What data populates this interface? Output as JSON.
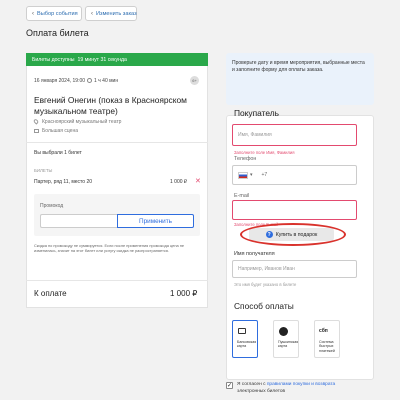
{
  "nav": {
    "back_event": "Выбор события",
    "change_order": "Изменить заказ"
  },
  "page_title": "Оплата билета",
  "timer_bar": {
    "label": "Билеты доступны",
    "time": "19 минут 31 секунда"
  },
  "event": {
    "date": "16 января 2024, 19:00",
    "duration": "1 ч 40 мин",
    "age": "6+",
    "title": "Евгений Онегин (показ в Красноярском музыкальном театре)",
    "venue": "Красноярский музыкальный театр",
    "hall": "Большая сцена"
  },
  "tickets": {
    "count_text": "Вы выбрали 1 билет",
    "section_label": "Билеты",
    "seat": "Партер, ряд 11, место 20",
    "price": "1 000 ₽"
  },
  "promo": {
    "label": "Промокод",
    "apply_button": "Применить",
    "note": "Скидка по промокоду не суммируется. Если после применения промокода цена не изменилась, значит на этот билет или услугу скидка не распространяется."
  },
  "total": {
    "label": "К оплате",
    "amount": "1 000 ₽"
  },
  "hint_text": "Проверьте дату и время мероприятия, выбранные места и заполните форму для оплаты заказа.",
  "buyer": {
    "heading": "Покупатель",
    "name_placeholder": "Имя, Фамилия",
    "name_error": "Заполните поле Имя, Фамилия",
    "phone_label": "Телефон",
    "phone_code": "+7",
    "email_label": "E-mail",
    "email_error": "Заполните поле E-mail",
    "gift_button": "Купить в подарок",
    "recipient_label": "Имя получателя",
    "recipient_placeholder": "Например, Иванов Иван",
    "recipient_hint": "Это имя будет указано в билете"
  },
  "payment": {
    "heading": "Способ оплаты",
    "methods": [
      {
        "label": "Банковская карта"
      },
      {
        "label": "Пушкинская карта"
      },
      {
        "label": "Система быстрых платежей",
        "badge": "сбп"
      }
    ]
  },
  "agreement": {
    "prefix": "Я согласен с",
    "link": "правилами покупки и возврата",
    "suffix": "электронных билетов"
  },
  "colors": {
    "accent": "#2f6dde",
    "timer_green": "#2aa84a",
    "error": "#e34a6f",
    "highlight_ring": "#d9322c"
  }
}
